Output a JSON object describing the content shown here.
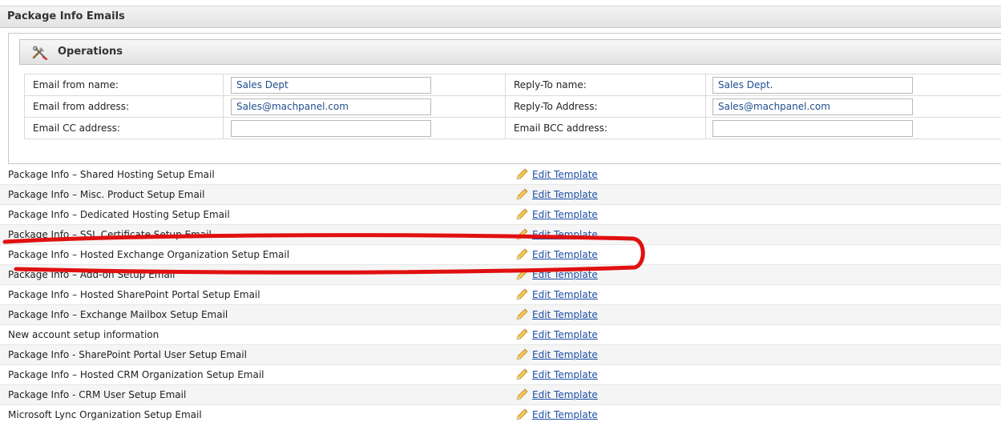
{
  "header": {
    "title": "Package Info Emails"
  },
  "operations": {
    "title": "Operations",
    "icon": "tools-icon",
    "fields": [
      {
        "label": "Email from name:",
        "value": "Sales Dept",
        "label2": "Reply-To name:",
        "value2": "Sales Dept."
      },
      {
        "label": "Email from address:",
        "value": "Sales@machpanel.com",
        "label2": "Reply-To Address:",
        "value2": "Sales@machpanel.com"
      },
      {
        "label": "Email CC address:",
        "value": "",
        "label2": "Email BCC address:",
        "value2": ""
      }
    ]
  },
  "templates": [
    {
      "name": "Package Info – Shared Hosting Setup Email",
      "action": "Edit Template"
    },
    {
      "name": "Package Info – Misc. Product Setup Email",
      "action": "Edit Template"
    },
    {
      "name": "Package Info – Dedicated Hosting Setup Email",
      "action": "Edit Template"
    },
    {
      "name": "Package Info – SSL Certificate Setup Email",
      "action": "Edit Template"
    },
    {
      "name": "Package Info – Hosted Exchange Organization Setup Email",
      "action": "Edit Template"
    },
    {
      "name": "Package Info – Add-on Setup Email",
      "action": "Edit Template"
    },
    {
      "name": "Package Info – Hosted SharePoint Portal Setup Email",
      "action": "Edit Template"
    },
    {
      "name": "Package Info – Exchange Mailbox Setup Email",
      "action": "Edit Template"
    },
    {
      "name": "New account setup information",
      "action": "Edit Template"
    },
    {
      "name": "Package Info - SharePoint Portal User Setup Email",
      "action": "Edit Template"
    },
    {
      "name": "Package Info – Hosted CRM Organization Setup Email",
      "action": "Edit Template"
    },
    {
      "name": "Package Info - CRM User Setup Email",
      "action": "Edit Template"
    },
    {
      "name": "Microsoft Lync Organization Setup Email",
      "action": "Edit Template"
    }
  ],
  "colors": {
    "link": "#1d4fa3",
    "annotation": "#e01010",
    "header_bg": "#e8e8e8"
  }
}
